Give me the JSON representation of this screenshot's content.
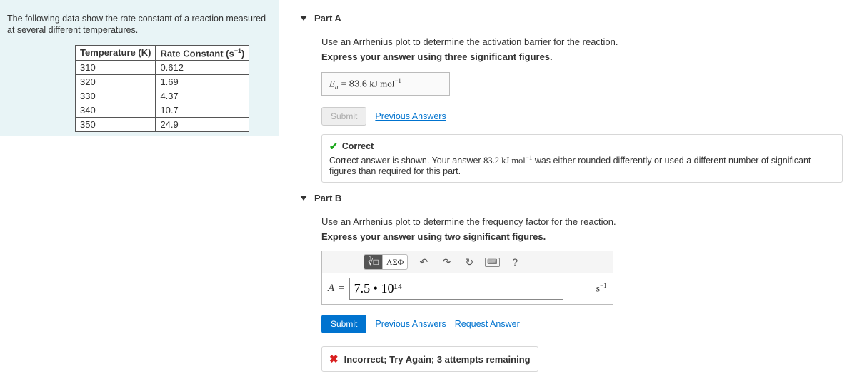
{
  "problem": {
    "statement": "The following data show the rate constant of a reaction measured at several different temperatures.",
    "table": {
      "headers": {
        "temp": "Temperature (K)",
        "rate": "Rate Constant (s",
        "rate_exp": "−1",
        "rate_close": ")"
      },
      "rows": [
        {
          "t": "310",
          "k": "0.612"
        },
        {
          "t": "320",
          "k": "1.69"
        },
        {
          "t": "330",
          "k": "4.37"
        },
        {
          "t": "340",
          "k": "10.7"
        },
        {
          "t": "350",
          "k": "24.9"
        }
      ]
    }
  },
  "partA": {
    "title": "Part A",
    "instruction": "Use an Arrhenius plot to determine the activation barrier for the reaction.",
    "express": "Express your answer using three significant figures.",
    "answer": {
      "sym": "E",
      "sub": "a",
      "eq": " = ",
      "val": "83.6",
      "unit_pre": "  kJ mol",
      "unit_exp": "−1"
    },
    "submit": "Submit",
    "prev": "Previous Answers",
    "feedback": {
      "title": "Correct",
      "msg_pre": "Correct answer is shown. Your answer ",
      "msg_ans": "83.2 kJ mol",
      "msg_ans_exp": "−1",
      "msg_post": " was either rounded differently or used a different number of significant figures than required for this part."
    }
  },
  "partB": {
    "title": "Part B",
    "instruction": "Use an Arrhenius plot to determine the frequency factor for the reaction.",
    "express": "Express your answer using two significant figures.",
    "toolbar": {
      "templates": "■",
      "fraction": "∛□",
      "greek": "ΑΣΦ",
      "undo": "↶",
      "redo": "↷",
      "reset": "↻",
      "keyboard": "⌨",
      "help": "?"
    },
    "equation": {
      "lhs": "A",
      "eq": " = ",
      "value": "7.5 • 10¹⁴",
      "unit": "s",
      "unit_exp": "−1"
    },
    "submit": "Submit",
    "prev": "Previous Answers",
    "request": "Request Answer",
    "incorrect": "Incorrect; Try Again; 3 attempts remaining"
  }
}
